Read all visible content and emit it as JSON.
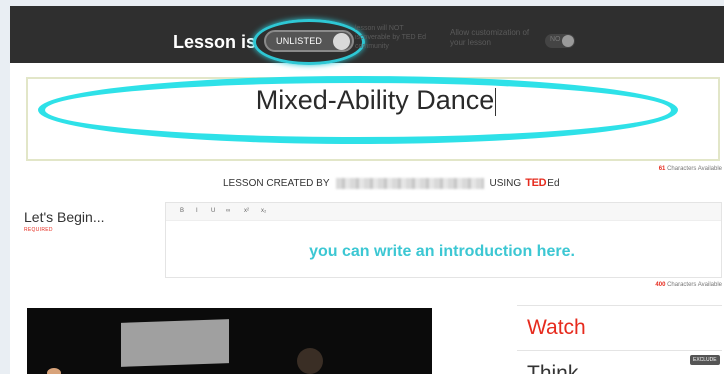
{
  "topbar": {
    "lesson_is": "Lesson is",
    "unlisted_label": "UNLISTED",
    "unlisted_notice": "lesson will NOT iscoverable by TED Ed community",
    "allow_text": "Allow customization of your lesson",
    "no_label": "NO"
  },
  "title": {
    "value": "Mixed-Ability Dance",
    "chars_count": "61",
    "chars_label": "Characters Available"
  },
  "created": {
    "prefix": "LESSON CREATED BY",
    "using": "USING",
    "ted": "TED",
    "ed": "Ed"
  },
  "begin": {
    "heading": "Let's Begin...",
    "required": "REQUIRED"
  },
  "editor": {
    "toolbar": [
      "B",
      "I",
      "U",
      "∞",
      "x²",
      "x₂"
    ],
    "placeholder": "you can write an introduction here.",
    "chars_count": "400",
    "chars_label": "Characters Available"
  },
  "nav": {
    "watch": "Watch",
    "think": "Think",
    "exclude": "EXCLUDE"
  },
  "colors": {
    "accent_red": "#e62b1e",
    "annotation_cyan": "#2ee1e8",
    "topbar": "#2f2f2f"
  }
}
